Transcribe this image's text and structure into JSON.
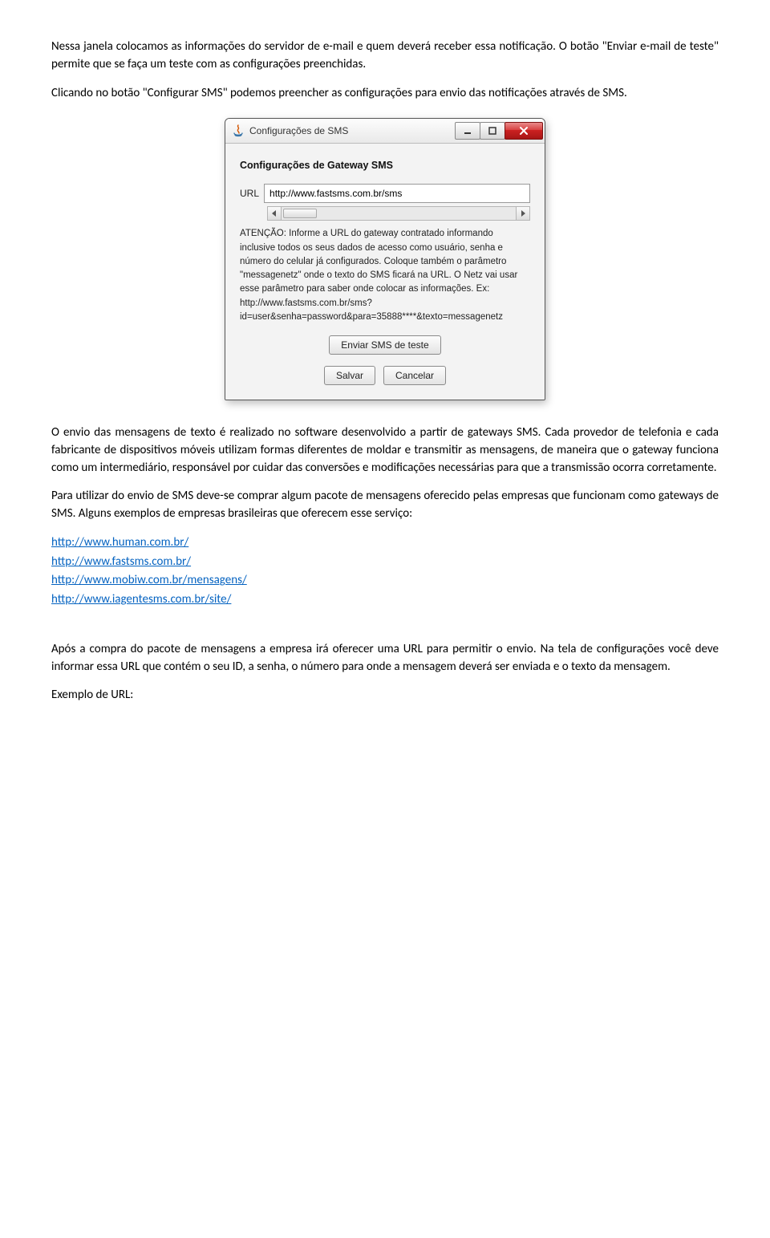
{
  "para1": "Nessa janela colocamos as informações do servidor de e-mail e quem deverá receber essa notificação. O botão \"Enviar e-mail de teste\" permite que se faça um teste com as configurações preenchidas.",
  "para2": "Clicando no botão \"Configurar SMS\" podemos preencher as configurações para envio das notificações através de SMS.",
  "dialog": {
    "title": "Configurações de SMS",
    "heading": "Configurações de Gateway SMS",
    "url_label": "URL",
    "url_value": "http://www.fastsms.com.br/sms",
    "warn_text": "ATENÇÃO: Informe a URL do gateway contratado informando inclusive todos os seus dados de acesso como usuário, senha e número do celular já configurados. Coloque também o parâmetro \"messagenetz\" onde o texto do SMS ficará na URL. O Netz vai usar esse parâmetro para saber onde colocar as informações. Ex: http://www.fastsms.com.br/sms?id=user&senha=password&para=35888****&texto=messagenetz",
    "btn_test": "Enviar SMS de teste",
    "btn_save": "Salvar",
    "btn_cancel": "Cancelar"
  },
  "para3": "O envio das mensagens de texto é realizado no software desenvolvido a partir de gateways SMS. Cada provedor de telefonia e cada fabricante de dispositivos móveis utilizam formas diferentes de moldar e transmitir as mensagens, de maneira que o gateway funciona como um intermediário, responsável por cuidar das conversões e modificações necessárias para que a transmissão ocorra corretamente.",
  "para4": "Para utilizar do envio de SMS deve-se comprar algum pacote de mensagens oferecido pelas empresas que funcionam como gateways de SMS. Alguns exemplos de empresas brasileiras que oferecem esse serviço:",
  "links": [
    "http://www.human.com.br/",
    "http://www.fastsms.com.br/",
    "http://www.mobiw.com.br/mensagens/",
    "http://www.iagentesms.com.br/site/"
  ],
  "para5": "Após a compra do pacote de mensagens a empresa irá oferecer uma URL para permitir o envio. Na tela de configurações você deve informar essa URL que contém o seu ID, a senha, o número para onde a mensagem deverá ser enviada e o texto da mensagem.",
  "para6": "Exemplo de URL:"
}
